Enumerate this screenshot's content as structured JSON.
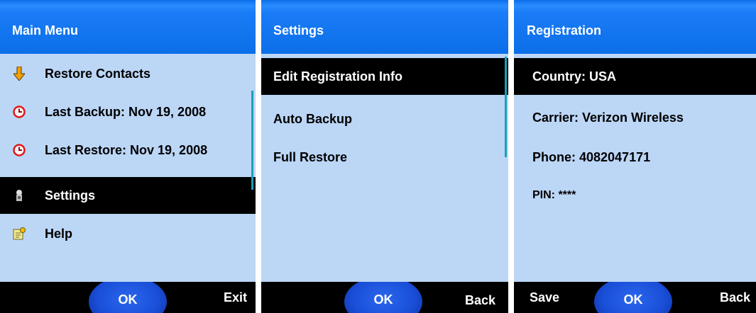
{
  "main_menu": {
    "title": "Main Menu",
    "items": [
      {
        "icon": "down-arrow-icon",
        "label": "Restore Contacts"
      },
      {
        "icon": "clock-icon",
        "label": "Last Backup: Nov 19, 2008"
      },
      {
        "icon": "clock-icon",
        "label": "Last Restore: Nov 19, 2008"
      },
      {
        "icon": "settings-icon",
        "label": "Settings",
        "selected": true
      },
      {
        "icon": "help-icon",
        "label": "Help"
      }
    ],
    "softkeys": {
      "center": "OK",
      "right": "Exit"
    }
  },
  "settings": {
    "title": "Settings",
    "items": [
      {
        "label": "Edit Registration Info",
        "selected": true
      },
      {
        "label": "Auto Backup"
      },
      {
        "label": "Full Restore"
      }
    ],
    "softkeys": {
      "center": "OK",
      "right": "Back"
    }
  },
  "registration": {
    "title": "Registration",
    "fields": [
      {
        "label": "Country: USA",
        "selected": true
      },
      {
        "label": "Carrier: Verizon Wireless"
      },
      {
        "label": "Phone: 4082047171"
      },
      {
        "label": "PIN: ****"
      }
    ],
    "softkeys": {
      "left": "Save",
      "center": "OK",
      "right": "Back"
    }
  },
  "colors": {
    "titlebar": "#0b6fe8",
    "background": "#bcd6f6",
    "selection": "#000000",
    "ok_button": "#1a4fd8",
    "scrollbar": "#1aa0b8"
  }
}
